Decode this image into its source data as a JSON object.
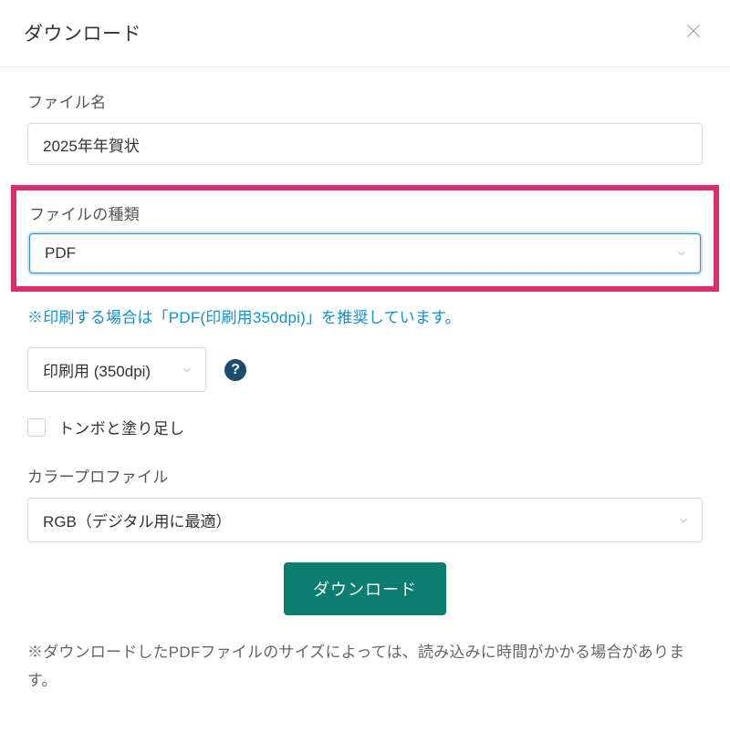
{
  "header": {
    "title": "ダウンロード"
  },
  "filename": {
    "label": "ファイル名",
    "value": "2025年年賀状"
  },
  "filetype": {
    "label": "ファイルの種類",
    "value": "PDF"
  },
  "recommend_text": "※印刷する場合は「PDF(印刷用350dpi)」を推奨しています。",
  "dpi": {
    "value": "印刷用 (350dpi)"
  },
  "help_label": "?",
  "trim_marks": {
    "label": "トンボと塗り足し"
  },
  "color_profile": {
    "label": "カラープロファイル",
    "value": "RGB（デジタル用に最適）"
  },
  "download_button_label": "ダウンロード",
  "footer_note": "※ダウンロードしたPDFファイルのサイズによっては、読み込みに時間がかかる場合があります。"
}
